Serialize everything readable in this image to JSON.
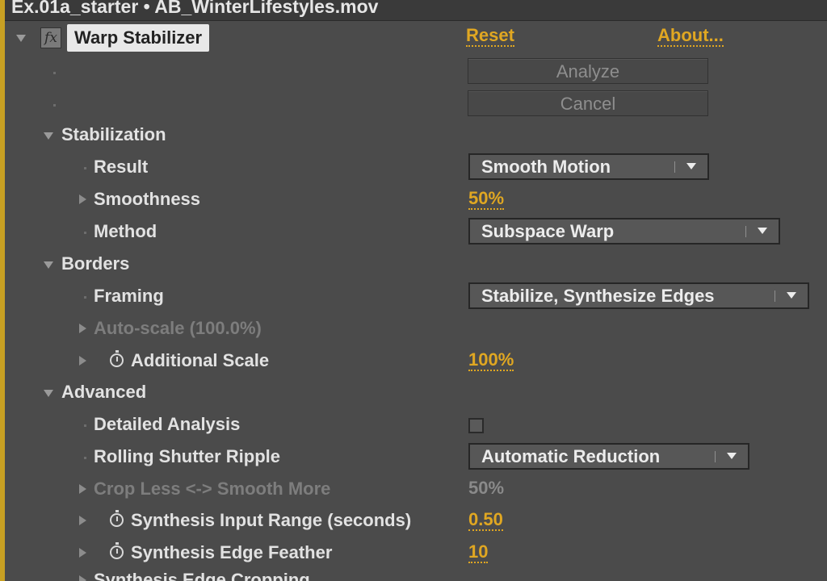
{
  "window": {
    "title": "Ex.01a_starter • AB_WinterLifestyles.mov"
  },
  "effect": {
    "fx_icon": "fx",
    "name": "Warp Stabilizer",
    "reset_label": "Reset",
    "about_label": "About...",
    "analyze_label": "Analyze",
    "cancel_label": "Cancel"
  },
  "stabilization": {
    "label": "Stabilization",
    "result": {
      "label": "Result",
      "value": "Smooth Motion"
    },
    "smoothness": {
      "label": "Smoothness",
      "value": "50%"
    },
    "method": {
      "label": "Method",
      "value": "Subspace Warp"
    }
  },
  "borders": {
    "label": "Borders",
    "framing": {
      "label": "Framing",
      "value": "Stabilize, Synthesize Edges"
    },
    "auto_scale": {
      "label": "Auto-scale (100.0%)"
    },
    "additional_scale": {
      "label": "Additional Scale",
      "value": "100%"
    }
  },
  "advanced": {
    "label": "Advanced",
    "detailed_analysis": {
      "label": "Detailed Analysis",
      "checked": false
    },
    "rolling_shutter": {
      "label": "Rolling Shutter Ripple",
      "value": "Automatic Reduction"
    },
    "crop_less": {
      "label": "Crop Less <-> Smooth More",
      "value": "50%"
    },
    "synthesis_input_range": {
      "label": "Synthesis Input Range (seconds)",
      "value": "0.50"
    },
    "synthesis_edge_feather": {
      "label": "Synthesis Edge Feather",
      "value": "10"
    },
    "synthesis_edge_cropping": {
      "label": "Synthesis Edge Cropping"
    }
  },
  "icons": {
    "twirl_open": "triangle-down-icon",
    "twirl_closed": "triangle-right-icon",
    "stopwatch": "stopwatch-icon",
    "dropdown": "chevron-down-icon"
  },
  "colors": {
    "accent": "#e0a722",
    "panel_bg": "#4b4b4b",
    "border_highlight": "#c8a023",
    "text": "#e2e2e2",
    "disabled_text": "#7d7d7d"
  }
}
